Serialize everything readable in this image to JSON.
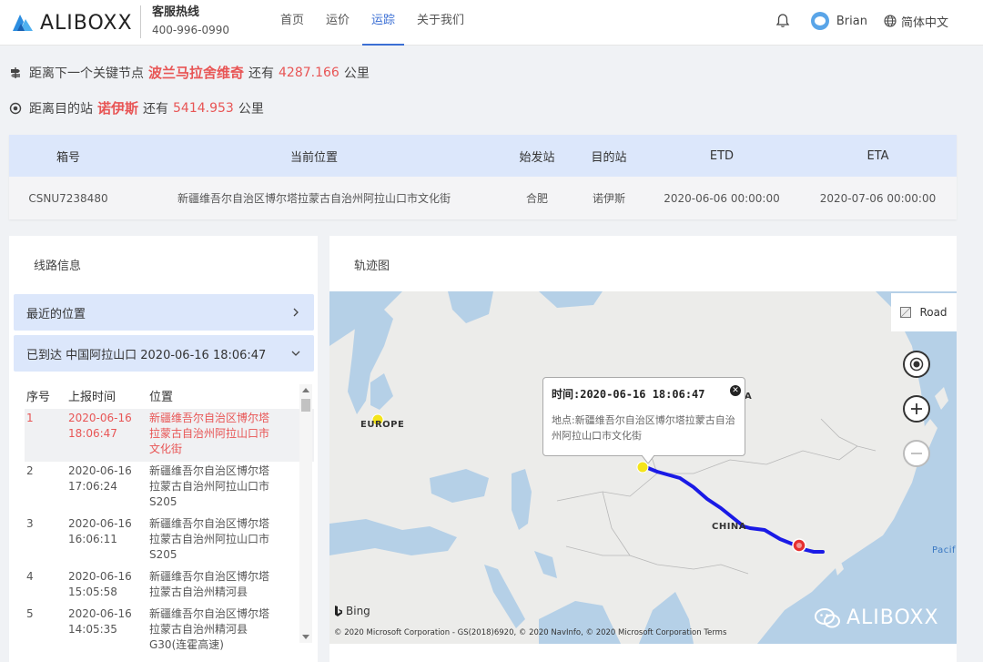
{
  "header": {
    "logo_text": "ALIBOXX",
    "hotline_label": "客服热线",
    "hotline_number": "400-996-0990",
    "nav": [
      {
        "label": "首页",
        "active": false
      },
      {
        "label": "运价",
        "active": false
      },
      {
        "label": "运踪",
        "active": true
      },
      {
        "label": "关于我们",
        "active": false
      }
    ],
    "user": "Brian",
    "language": "简体中文"
  },
  "distance": {
    "next_prefix": "距离下一个关键节点",
    "next_node": "波兰马拉舍维奇",
    "next_mid": "还有",
    "next_km": "4287.166",
    "next_unit": "公里",
    "dest_prefix": "距离目的站",
    "dest_node": "诺伊斯",
    "dest_mid": "还有",
    "dest_km": "5414.953",
    "dest_unit": "公里"
  },
  "container_table": {
    "headers": [
      "箱号",
      "当前位置",
      "始发站",
      "目的站",
      "ETD",
      "ETA"
    ],
    "row": [
      "CSNU7238480",
      "新疆维吾尔自治区博尔塔拉蒙古自治州阿拉山口市文化街",
      "合肥",
      "诺伊斯",
      "2020-06-06 00:00:00",
      "2020-07-06 00:00:00"
    ]
  },
  "route_panel": {
    "title": "线路信息",
    "recent_label": "最近的位置",
    "arrived_label": "已到达 中国阿拉山口 2020-06-16 18:06:47",
    "headers": [
      "序号",
      "上报时间",
      "位置"
    ],
    "rows": [
      {
        "no": "1",
        "time": "2020-06-16 18:06:47",
        "loc": "新疆维吾尔自治区博尔塔拉蒙古自治州阿拉山口市文化街"
      },
      {
        "no": "2",
        "time": "2020-06-16 17:06:24",
        "loc": "新疆维吾尔自治区博尔塔拉蒙古自治州阿拉山口市S205"
      },
      {
        "no": "3",
        "time": "2020-06-16 16:06:11",
        "loc": "新疆维吾尔自治区博尔塔拉蒙古自治州阿拉山口市S205"
      },
      {
        "no": "4",
        "time": "2020-06-16 15:05:58",
        "loc": "新疆维吾尔自治区博尔塔拉蒙古自治州精河县"
      },
      {
        "no": "5",
        "time": "2020-06-16 14:05:35",
        "loc": "新疆维吾尔自治区博尔塔拉蒙古自治州精河县G30(连霍高速)"
      }
    ]
  },
  "map_panel": {
    "title": "轨迹图",
    "road_label": "Road",
    "popup_time": "时间:2020-06-16 18:06:47",
    "popup_addr": "地点:新疆维吾尔自治区博尔塔拉蒙古自治州阿拉山口市文化街",
    "label_europe": "EUROPE",
    "label_china": "CHINA",
    "label_asia_partial": "A",
    "label_pacific": "Pacif",
    "bing": "Bing",
    "copyright": "© 2020 Microsoft Corporation - GS(2018)6920, © 2020 NavInfo, © 2020 Microsoft Corporation  Terms",
    "watermark": "ALIBOXX",
    "route_color": "#1a1ae6"
  }
}
